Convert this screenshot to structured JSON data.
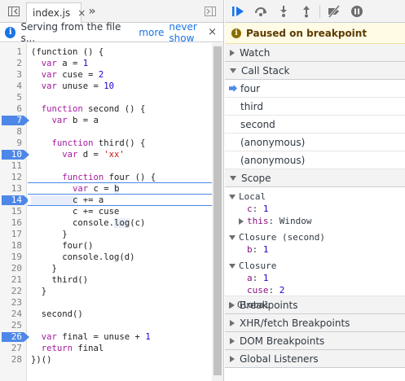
{
  "tabs": {
    "file_tab_label": "index.js",
    "close": "×",
    "more": "»"
  },
  "infobar": {
    "message": "Serving from the file s...",
    "more_link": "more",
    "never_show_link": "never show",
    "close": "×"
  },
  "editor": {
    "line_numbers": [
      "1",
      "2",
      "3",
      "4",
      "5",
      "6",
      "7",
      "8",
      "9",
      "10",
      "11",
      "12",
      "13",
      "14",
      "15",
      "16",
      "17",
      "18",
      "19",
      "20",
      "21",
      "22",
      "23",
      "24",
      "25",
      "26",
      "27",
      "28"
    ],
    "breakpoint_lines": [
      7,
      10,
      14,
      26
    ],
    "current_line": 14
  },
  "paused_banner": "Paused on breakpoint",
  "sections": {
    "watch": "Watch",
    "call_stack": "Call Stack",
    "scope": "Scope",
    "breakpoints": "Breakpoints",
    "xhr_breakpoints": "XHR/fetch Breakpoints",
    "dom_breakpoints": "DOM Breakpoints",
    "global_listeners": "Global Listeners"
  },
  "call_stack": [
    "four",
    "third",
    "second",
    "(anonymous)",
    "(anonymous)"
  ],
  "scope": {
    "local_label": "Local",
    "local_c_name": "c",
    "local_c_value": "1",
    "local_this_name": "this",
    "local_this_value": "Window",
    "closure_second_label": "Closure (second)",
    "closure_second_b_name": "b",
    "closure_second_b_value": "1",
    "closure_label": "Closure",
    "closure_a_name": "a",
    "closure_a_value": "1",
    "closure_cuse_name": "cuse",
    "closure_cuse_value": "2",
    "global_label": "Global"
  },
  "colors": {
    "accent": "#4e87e8",
    "paused_bg": "#fffbe5",
    "keyword": "#a41a9e",
    "number": "#1c00cf",
    "string": "#c41a16"
  },
  "icons": [
    "toggle-navigator-icon",
    "close-icon",
    "more-tabs-icon",
    "info-icon",
    "toggle-debugger-icon",
    "resume-icon",
    "step-over-icon",
    "step-into-icon",
    "step-out-icon",
    "deactivate-breakpoints-icon",
    "pause-on-exceptions-icon"
  ]
}
